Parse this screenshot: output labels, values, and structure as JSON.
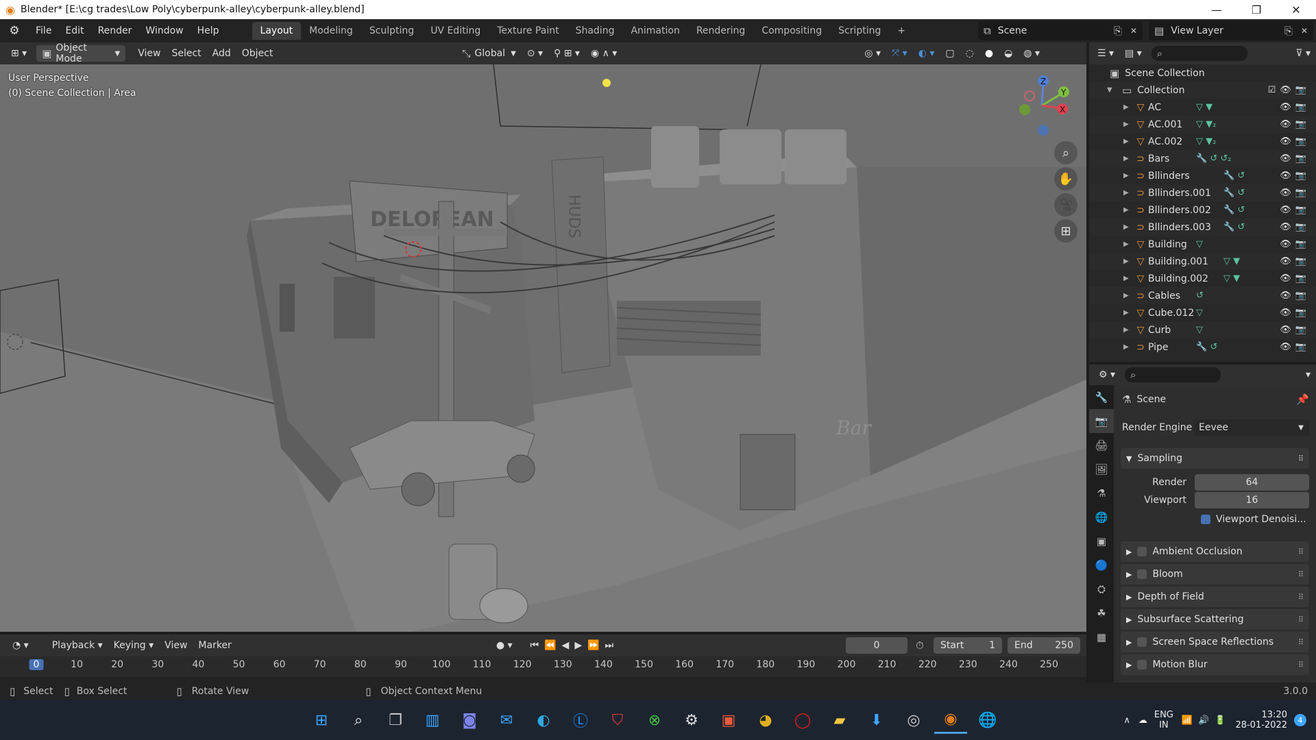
{
  "window": {
    "title": "Blender* [E:\\cg trades\\Low Poly\\cyberpunk-alley\\cyberpunk-alley.blend]",
    "controls": [
      "—",
      "❐",
      "✕"
    ]
  },
  "menu": {
    "items": [
      "File",
      "Edit",
      "Render",
      "Window",
      "Help"
    ],
    "workspaces": [
      "Layout",
      "Modeling",
      "Sculpting",
      "UV Editing",
      "Texture Paint",
      "Shading",
      "Animation",
      "Rendering",
      "Compositing",
      "Scripting",
      "+"
    ],
    "active_workspace": "Layout",
    "scene": "Scene",
    "view_layer": "View Layer"
  },
  "viewport_header": {
    "mode": "Object Mode",
    "menus": [
      "View",
      "Select",
      "Add",
      "Object"
    ],
    "orientation": "Global"
  },
  "viewport": {
    "perspective_label": "User Perspective",
    "collection_label": "(0) Scene Collection | Area",
    "gizmo_axes": [
      "Z",
      "Y",
      "X"
    ],
    "signs": {
      "delorean": "DELOREAN",
      "vertical": "HUDS",
      "bar": "Bar"
    }
  },
  "outliner": {
    "root": "Scene Collection",
    "collection": "Collection",
    "items": [
      {
        "name": "AC",
        "type": "mesh",
        "mods": "▽ ▼"
      },
      {
        "name": "AC.001",
        "type": "mesh",
        "mods": "▽ ▼₂"
      },
      {
        "name": "AC.002",
        "type": "mesh",
        "mods": "▽ ▼₂"
      },
      {
        "name": "Bars",
        "type": "curve",
        "mods": "🔧 ↺ ↺₂"
      },
      {
        "name": "Bllinders",
        "type": "curve",
        "mods": "🔧 ↺"
      },
      {
        "name": "Bllinders.001",
        "type": "curve",
        "mods": "🔧 ↺"
      },
      {
        "name": "Bllinders.002",
        "type": "curve",
        "mods": "🔧 ↺"
      },
      {
        "name": "Bllinders.003",
        "type": "curve",
        "mods": "🔧 ↺"
      },
      {
        "name": "Building",
        "type": "mesh",
        "mods": "▽"
      },
      {
        "name": "Building.001",
        "type": "mesh",
        "mods": "▽ ▼"
      },
      {
        "name": "Building.002",
        "type": "mesh",
        "mods": "▽ ▼"
      },
      {
        "name": "Cables",
        "type": "curve",
        "mods": "↺"
      },
      {
        "name": "Cube.012",
        "type": "mesh",
        "mods": "▽"
      },
      {
        "name": "Curb",
        "type": "mesh",
        "mods": "▽"
      },
      {
        "name": "Pipe",
        "type": "curve",
        "mods": "🔧 ↺"
      }
    ]
  },
  "properties": {
    "context": "Scene",
    "render_engine_label": "Render Engine",
    "render_engine": "Eevee",
    "sampling_label": "Sampling",
    "render_label": "Render",
    "render_samples": "64",
    "viewport_label": "Viewport",
    "viewport_samples": "16",
    "viewport_denoise": "Viewport Denoisi...",
    "panels": [
      "Ambient Occlusion",
      "Bloom",
      "Depth of Field",
      "Subsurface Scattering",
      "Screen Space Reflections",
      "Motion Blur"
    ],
    "panels_with_checkbox": [
      true,
      true,
      false,
      false,
      true,
      true
    ]
  },
  "timeline": {
    "menus": [
      "Playback",
      "Keying",
      "View",
      "Marker"
    ],
    "current_frame": "0",
    "start_label": "Start",
    "start": "1",
    "end_label": "End",
    "end": "250",
    "ticks": [
      "0",
      "10",
      "20",
      "30",
      "40",
      "50",
      "60",
      "70",
      "80",
      "90",
      "100",
      "110",
      "120",
      "130",
      "140",
      "150",
      "160",
      "170",
      "180",
      "190",
      "200",
      "210",
      "220",
      "230",
      "240",
      "250"
    ]
  },
  "statusbar": {
    "select": "Select",
    "box_select": "Box Select",
    "rotate": "Rotate View",
    "context_menu": "Object Context Menu",
    "version": "3.0.0"
  },
  "taskbar": {
    "lang1": "ENG",
    "lang2": "IN",
    "time": "13:20",
    "date": "28-01-2022",
    "badge": "4"
  },
  "colors": {
    "accent": "#4772b3",
    "blender_orange": "#e87d0d",
    "viewport_bg": "#6f6f6f"
  }
}
